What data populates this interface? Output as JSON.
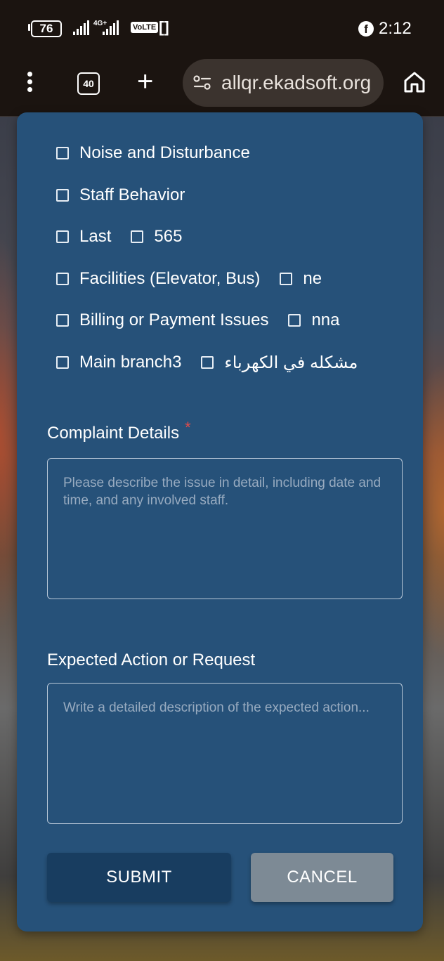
{
  "status_bar": {
    "battery": "76",
    "network": "4G+",
    "volte": "VoLTE",
    "time": "2:12"
  },
  "browser": {
    "tab_count": "40",
    "url": "allqr.ekadsoft.org"
  },
  "form": {
    "checkbox_rows": [
      [
        "Noise and Disturbance"
      ],
      [
        "Staff Behavior"
      ],
      [
        "Last",
        "565"
      ],
      [
        "Facilities (Elevator, Bus)",
        "ne"
      ],
      [
        "Billing or Payment Issues",
        "nna"
      ],
      [
        "Main branch3",
        "مشكله في الكهرباء"
      ]
    ],
    "complaint_details": {
      "label": "Complaint Details",
      "required_mark": "*",
      "placeholder": "Please describe the issue in detail, including date and time, and any involved staff."
    },
    "expected_action": {
      "label": "Expected Action or Request",
      "placeholder": "Write a detailed description of the expected action..."
    },
    "submit_label": "SUBMIT",
    "cancel_label": "CANCEL"
  },
  "colors": {
    "card_background": "#265179",
    "submit_button": "#183d60",
    "cancel_button": "#7d8a95",
    "required_star": "#e24b4b"
  }
}
